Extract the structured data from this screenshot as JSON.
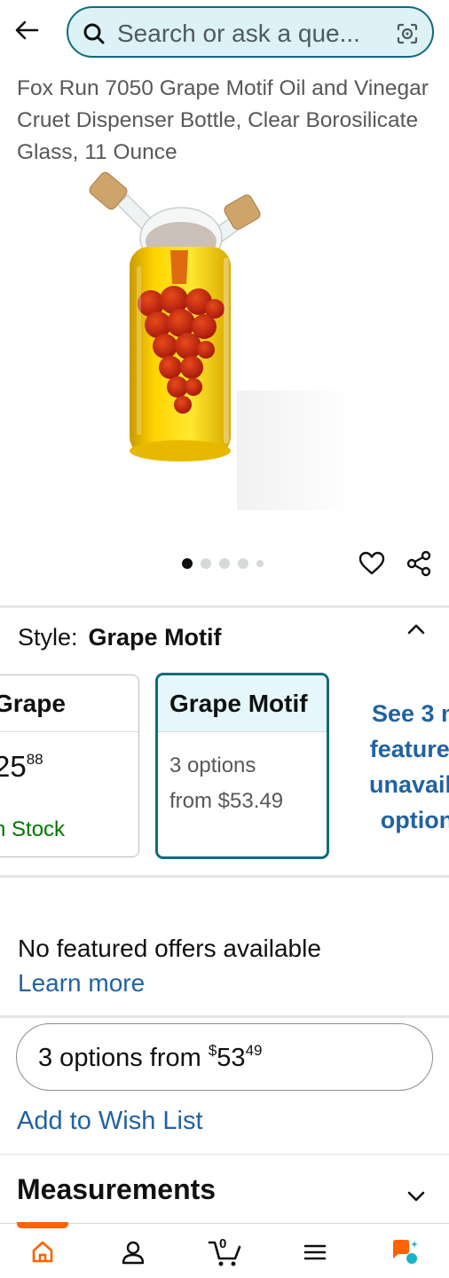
{
  "search": {
    "placeholder": "Search or ask a que..."
  },
  "product": {
    "title": "Fox Run 7050 Grape Motif Oil and Vinegar Cruet Dispenser Bottle, Clear Borosilicate Glass, 11 Ounce",
    "image_count": 5,
    "active_image": 1
  },
  "style": {
    "label": "Style:",
    "selected": "Grape Motif",
    "cards": [
      {
        "name": "Grape",
        "price_whole": "25",
        "price_fraction": "88",
        "availability": "n Stock"
      },
      {
        "name": "Grape Motif",
        "options_line": "3 options",
        "from_line": "from $53.49"
      }
    ],
    "see_more_lines": [
      "See 3 m",
      "featured",
      "unavaila",
      "option"
    ]
  },
  "offers": {
    "no_offers": "No featured offers available",
    "learn_more": "Learn more",
    "options_prefix": "3 options from ",
    "options_currency": "$",
    "options_whole": "53",
    "options_fraction": "49"
  },
  "wishlist_label": "Add to Wish List",
  "measurements_label": "Measurements",
  "nav": {
    "cart_count": "0"
  },
  "colors": {
    "accent_teal": "#0f6b7d",
    "link_blue": "#2162a1",
    "in_stock_green": "#007600",
    "nav_orange": "#ff6200"
  },
  "icons": [
    "back-arrow-icon",
    "search-icon",
    "camera-lens-icon",
    "heart-icon",
    "share-icon",
    "chevron-up-icon",
    "chevron-down-icon",
    "home-icon",
    "account-icon",
    "cart-icon",
    "menu-icon",
    "rufus-icon"
  ]
}
